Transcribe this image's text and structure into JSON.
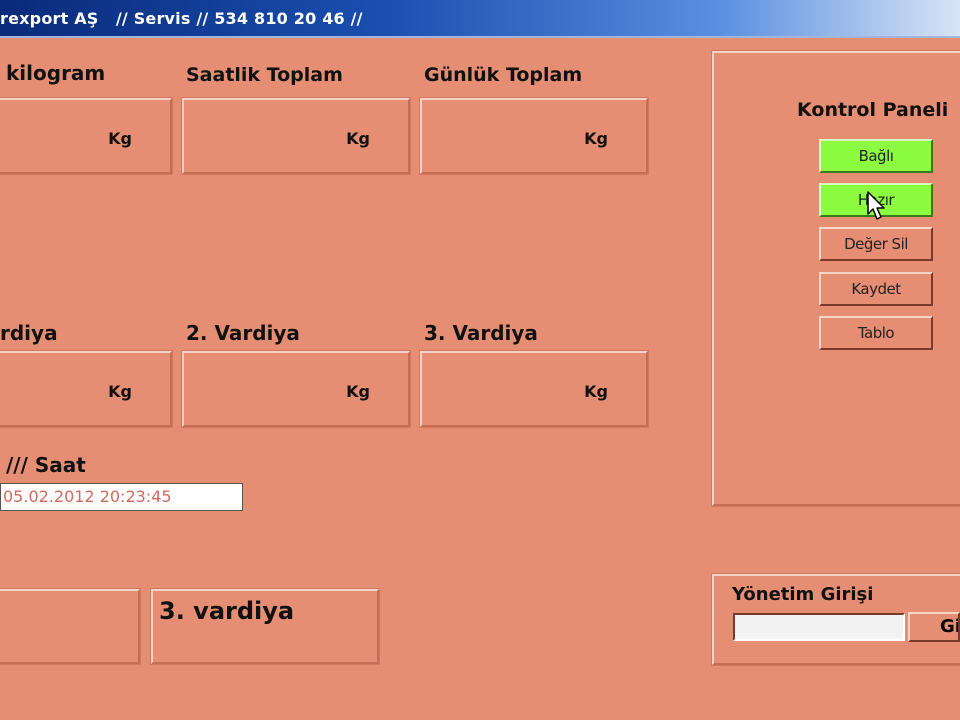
{
  "window": {
    "title": "rexport AŞ   // Servis // 534 810 20 46 //"
  },
  "totals": {
    "kilogram_label": "kilogram",
    "saatlik_label": "Saatlik  Toplam",
    "gunluk_label": "Günlük Toplam",
    "unit": "Kg"
  },
  "shifts": {
    "v1_label": "rdiya",
    "v2_label": "2. Vardiya",
    "v3_label": "3. Vardiya",
    "unit": "Kg"
  },
  "clock": {
    "label": "/// Saat",
    "value": "05.02.2012 20:23:45"
  },
  "current_shift": {
    "text": "3. vardiya"
  },
  "control_panel": {
    "title": "Kontrol Paneli",
    "buttons": {
      "bagli": "Bağlı",
      "hazir": "Hazır",
      "deger_sil": "Değer Sil",
      "kaydet": "Kaydet",
      "tablo": "Tablo"
    }
  },
  "management": {
    "title": "Yönetim Girişi",
    "login_button": "Giriş"
  },
  "colors": {
    "background": "#e58e74",
    "button_active": "#8cfc40",
    "clock_text": "#d06a5a"
  }
}
